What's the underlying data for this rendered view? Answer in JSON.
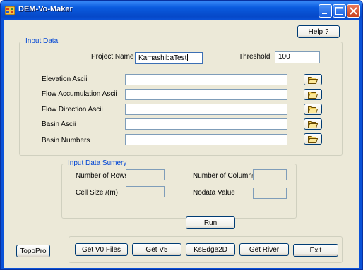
{
  "window": {
    "title": "DEM-Vo-Maker"
  },
  "help_label": "Help ?",
  "input_data": {
    "group_label": "Input Data",
    "project_name_label": "Project Name",
    "project_name_value": "KamashibaTest",
    "threshold_label": "Threshold",
    "threshold_value": "100",
    "files": [
      {
        "label": "Elevation Ascii",
        "value": ""
      },
      {
        "label": "Flow Accumulation Ascii",
        "value": ""
      },
      {
        "label": "Flow Direction Ascii",
        "value": ""
      },
      {
        "label": "Basin  Ascii",
        "value": ""
      },
      {
        "label": "Basin  Numbers",
        "value": ""
      }
    ]
  },
  "summary": {
    "group_label": "Input Data Sumery",
    "rows_label": "Number of Rows",
    "columns_label": "Number of Columns",
    "cell_size_label": "Cell Size /(m)",
    "nodata_label": "Nodata Value",
    "rows_value": "",
    "columns_value": "",
    "cell_size_value": "",
    "nodata_value": ""
  },
  "run_label": "Run",
  "toolbar": {
    "topopro_label": "TopoPro",
    "get_v0_label": "Get V0 Files",
    "get_v5_label": "Get V5",
    "ksedge_label": "KsEdge2D",
    "get_river_label": "Get River",
    "exit_label": "Exit"
  },
  "colors": {
    "titlebar": "#0a52d8",
    "client": "#ece9d8",
    "group_label": "#0046d5"
  },
  "icons": {
    "app": "app-icon",
    "browse": "folder-open-icon",
    "minimize": "minimize-icon",
    "maximize": "maximize-icon",
    "close": "close-icon"
  }
}
